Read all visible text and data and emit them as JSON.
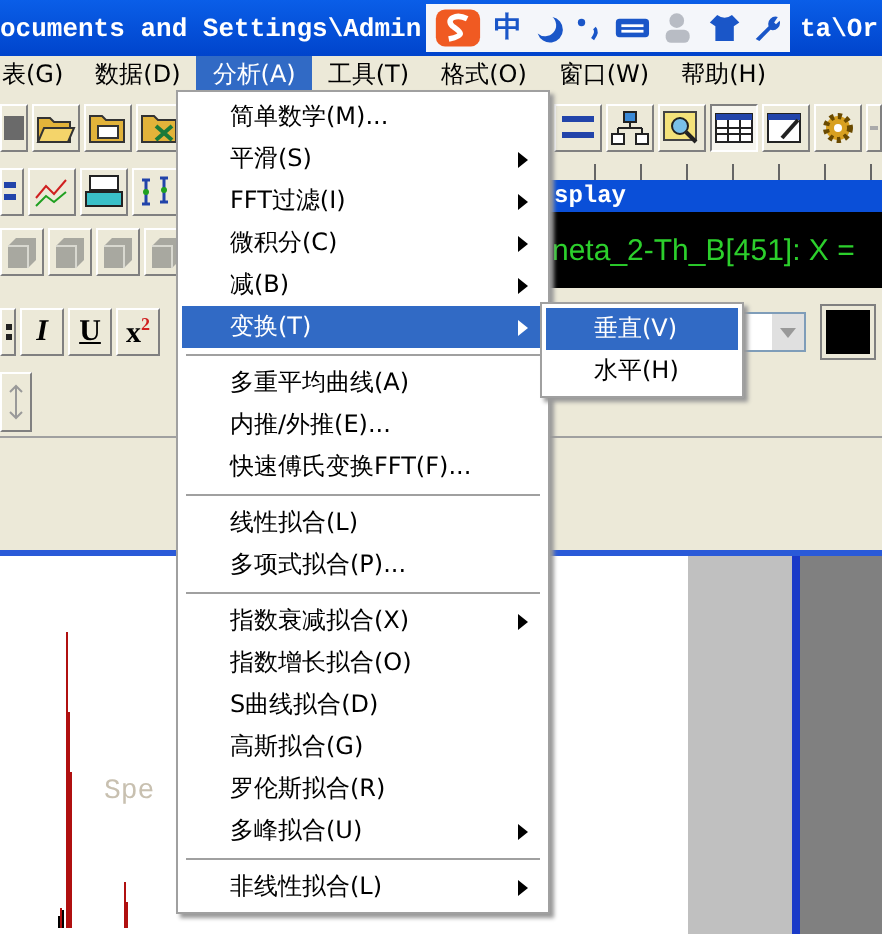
{
  "title_bar": {
    "text_left": "ocuments and Settings\\Admin",
    "text_right": "ta\\Or"
  },
  "ime_toolbar": {
    "mode": "中"
  },
  "menu_bar": [
    {
      "label": "表(G)",
      "selected": false
    },
    {
      "label": "数据(D)",
      "selected": false
    },
    {
      "label": "分析(A)",
      "selected": true
    },
    {
      "label": "工具(T)",
      "selected": false
    },
    {
      "label": "格式(O)",
      "selected": false
    },
    {
      "label": "窗口(W)",
      "selected": false
    },
    {
      "label": "帮助(H)",
      "selected": false
    }
  ],
  "graph_window": {
    "title": "splay",
    "readout": "neta_2-Th_B[451]: X =",
    "graph_label": "Spe"
  },
  "format_toolbar": {
    "buttons": [
      "I",
      "U",
      "x$^{2}$"
    ]
  },
  "menu": [
    {
      "kind": "item",
      "label": "简单数学(M)...",
      "submenu": false,
      "selected": false
    },
    {
      "kind": "item",
      "label": "平滑(S)",
      "submenu": true,
      "selected": false
    },
    {
      "kind": "item",
      "label": "FFT过滤(I)",
      "submenu": true,
      "selected": false
    },
    {
      "kind": "item",
      "label": "微积分(C)",
      "submenu": true,
      "selected": false
    },
    {
      "kind": "item",
      "label": "减(B)",
      "submenu": true,
      "selected": false
    },
    {
      "kind": "item",
      "label": "变换(T)",
      "submenu": true,
      "selected": true
    },
    {
      "kind": "separator"
    },
    {
      "kind": "item",
      "label": "多重平均曲线(A)",
      "submenu": false,
      "selected": false
    },
    {
      "kind": "item",
      "label": "内推/外推(E)...",
      "submenu": false,
      "selected": false
    },
    {
      "kind": "item",
      "label": "快速傅氏变换FFT(F)...",
      "submenu": false,
      "selected": false
    },
    {
      "kind": "separator"
    },
    {
      "kind": "item",
      "label": "线性拟合(L)",
      "submenu": false,
      "selected": false
    },
    {
      "kind": "item",
      "label": "多项式拟合(P)...",
      "submenu": false,
      "selected": false
    },
    {
      "kind": "separator"
    },
    {
      "kind": "item",
      "label": "指数衰减拟合(X)",
      "submenu": true,
      "selected": false
    },
    {
      "kind": "item",
      "label": "指数增长拟合(O)",
      "submenu": false,
      "selected": false
    },
    {
      "kind": "item",
      "label": "S曲线拟合(D)",
      "submenu": false,
      "selected": false
    },
    {
      "kind": "item",
      "label": "高斯拟合(G)",
      "submenu": false,
      "selected": false
    },
    {
      "kind": "item",
      "label": "罗伦斯拟合(R)",
      "submenu": false,
      "selected": false
    },
    {
      "kind": "item",
      "label": "多峰拟合(U)",
      "submenu": true,
      "selected": false
    },
    {
      "kind": "separator"
    },
    {
      "kind": "item",
      "label": "非线性拟合(L)",
      "submenu": true,
      "selected": false
    }
  ],
  "submenu": [
    {
      "label": "垂直(V)",
      "selected": true
    },
    {
      "label": "水平(H)",
      "selected": false
    }
  ]
}
